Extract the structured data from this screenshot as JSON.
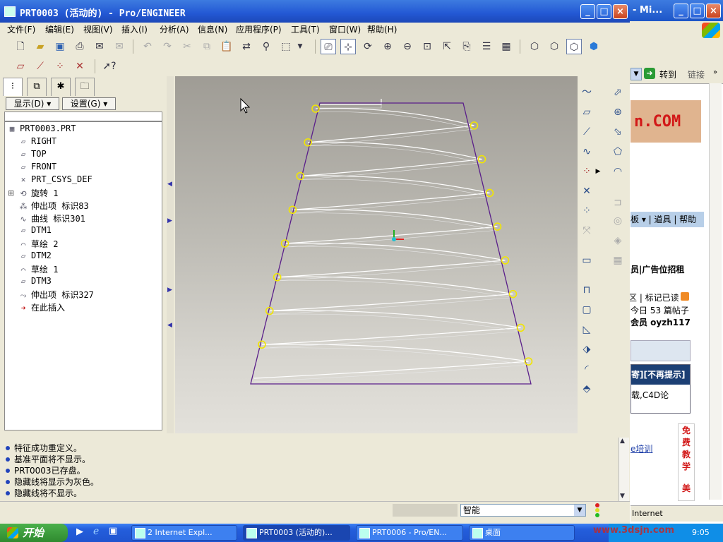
{
  "window": {
    "title": "PRT0003 (活动的) - Pro/ENGINEER",
    "controls": {
      "minimize": "_",
      "maximize": "□",
      "close": "×"
    }
  },
  "menu": [
    "文件(F)",
    "编辑(E)",
    "视图(V)",
    "插入(I)",
    "分析(A)",
    "信息(N)",
    "应用程序(P)",
    "工具(T)",
    "窗口(W)",
    "帮助(H)"
  ],
  "left_panel": {
    "tabs": [
      "model-tree",
      "layers",
      "favorites",
      "folder"
    ],
    "show_button": "显示(D)",
    "settings_button": "设置(G)",
    "tree": [
      {
        "label": "PRT0003.PRT",
        "icon": "part-icon",
        "indent": 0
      },
      {
        "label": "RIGHT",
        "icon": "datum-plane-icon",
        "indent": 1
      },
      {
        "label": "TOP",
        "icon": "datum-plane-icon",
        "indent": 1
      },
      {
        "label": "FRONT",
        "icon": "datum-plane-icon",
        "indent": 1
      },
      {
        "label": "PRT_CSYS_DEF",
        "icon": "csys-icon",
        "indent": 1
      },
      {
        "label": "旋转 1",
        "icon": "revolve-icon",
        "indent": 1
      },
      {
        "label": "伸出项 标识83",
        "icon": "protrusion-icon",
        "indent": 1
      },
      {
        "label": "曲线 标识301",
        "icon": "curve-icon",
        "indent": 1
      },
      {
        "label": "DTM1",
        "icon": "datum-plane-icon",
        "indent": 1
      },
      {
        "label": "草绘 2",
        "icon": "sketch-icon",
        "indent": 1
      },
      {
        "label": "DTM2",
        "icon": "datum-plane-icon",
        "indent": 1
      },
      {
        "label": "草绘 1",
        "icon": "sketch-icon",
        "indent": 1
      },
      {
        "label": "DTM3",
        "icon": "datum-plane-icon",
        "indent": 1
      },
      {
        "label": "伸出项 标识327",
        "icon": "sweep-icon",
        "indent": 1
      },
      {
        "label": "在此插入",
        "icon": "insert-here-icon",
        "indent": 1
      }
    ]
  },
  "messages": [
    "特征成功重定义。",
    "基准平面将不显示。",
    "PRT0003已存盘。",
    "隐藏线将显示为灰色。",
    "隐藏线将不显示。"
  ],
  "status": {
    "filter_value": "智能"
  },
  "colors": {
    "profile_line": "#5a1f8a",
    "spring_line": "#ffffff",
    "point_marker": "#f2e600",
    "title_blue": "#2358d4"
  },
  "background_window": {
    "title": "- Mi...",
    "go_button": "转到",
    "links_button": "链接",
    "banner_text": "n.COM",
    "forum_nav": "板 ▾ | 道具 | 帮助",
    "text_lines": [
      "员|广告位招租",
      "区 | 标记已读",
      "今日 53 篇帖子",
      "会员 oyzh117"
    ],
    "box_header": "寄][不再提示]",
    "box_text": "载,C4D论",
    "link_text": "e培训",
    "red_text": [
      "免",
      "费",
      "教",
      "学",
      "美"
    ],
    "status_text": "Internet"
  },
  "taskbar": {
    "start": "开始",
    "buttons": [
      "2 Internet Expl...",
      "PRT0003 (活动的)...",
      "PRT0006 - Pro/EN...",
      "桌面"
    ],
    "watermark": "www.3dsjn.com",
    "clock": "9:05"
  }
}
